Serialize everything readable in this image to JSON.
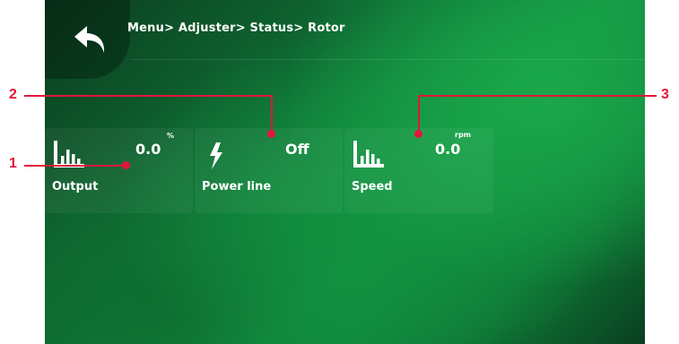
{
  "breadcrumb": "Menu> Adjuster> Status> Rotor",
  "tiles": [
    {
      "label": "Output",
      "value": "0.0",
      "unit": "%",
      "icon": "bar-chart-icon"
    },
    {
      "label": "Power line",
      "value": "Off",
      "unit": "",
      "icon": "lightning-icon"
    },
    {
      "label": "Speed",
      "value": "0.0",
      "unit": "rpm",
      "icon": "bar-chart-icon"
    }
  ],
  "callouts": [
    "1",
    "2",
    "3"
  ],
  "colors": {
    "accent": "#e2153b",
    "background": "#129744",
    "text": "#ffffff"
  }
}
